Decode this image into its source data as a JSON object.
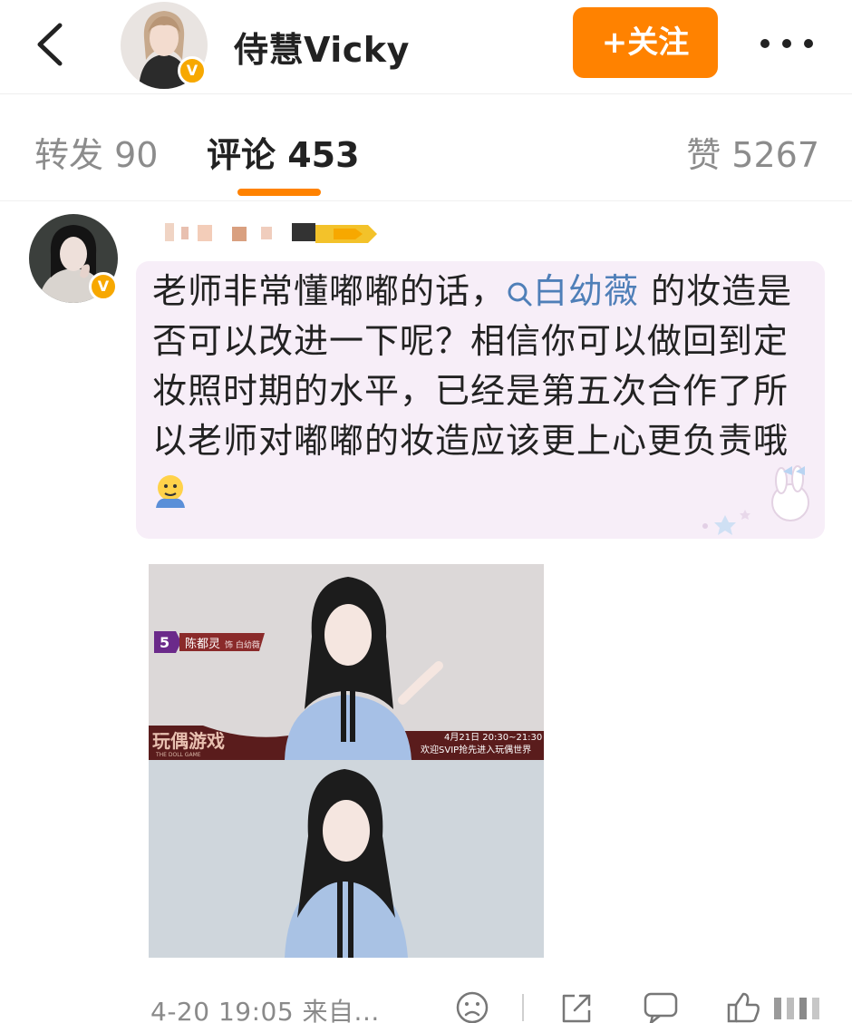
{
  "header": {
    "user_name": "侍慧Vicky",
    "follow_label": "+关注",
    "icons": {
      "back": "chevron-left-icon",
      "more": "more-dots-icon",
      "verified": "verified-v-icon"
    }
  },
  "tabs": {
    "repost_label": "转发 90",
    "comment_label": "评论 453",
    "like_label": "赞 5267",
    "active": "评论"
  },
  "comment": {
    "text_before_link": "老师非常懂嘟嘟的话，",
    "topic_link": "白幼薇",
    "text_after_link": " 的妆造是否可以改进一下呢？相信你可以做回到定妆照时期的水平，已经是第五次合作了所以老师对嘟嘟的妆造应该更上心更负责哦",
    "emoji": "facepalm-emoji",
    "image": {
      "badge_number": "5",
      "role_name": "陈都灵",
      "role_sub": "饰 白幼薇",
      "show_title": "玩偶游戏",
      "show_subtitle": "THE DOLL GAME",
      "air_time": "4月21日 20:30~21:30",
      "air_note": "欢迎SVIP抢先进入玩偶世界"
    }
  },
  "footer": {
    "time_label": "4-20 19:05 来自...",
    "icons": [
      "sad-face-icon",
      "share-icon",
      "comment-icon",
      "like-icon"
    ]
  },
  "colors": {
    "accent": "#ff8200",
    "link": "#4f7fb8",
    "bubble": "#f7eef8",
    "verified": "#f7a800"
  }
}
